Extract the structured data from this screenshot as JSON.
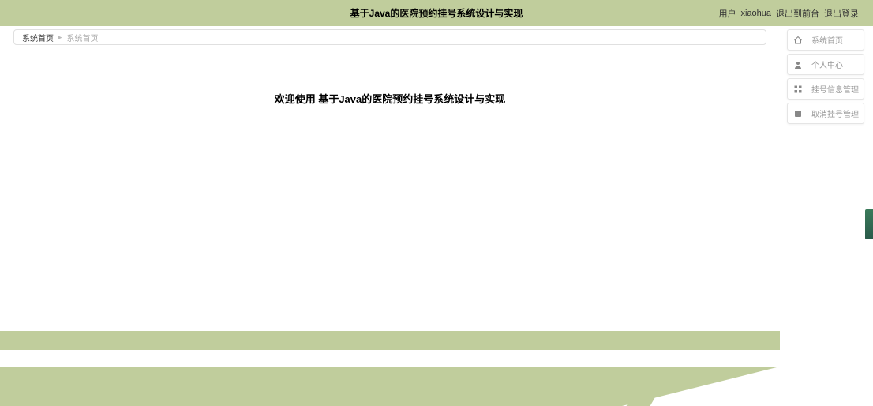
{
  "header": {
    "title": "基于Java的医院预约挂号系统设计与实现",
    "user_prefix": "用户",
    "username": "xiaohua",
    "back_label": "退出到前台",
    "logout_label": "退出登录"
  },
  "breadcrumb": {
    "home": "系统首页",
    "current": "系统首页"
  },
  "main": {
    "welcome": "欢迎使用 基于Java的医院预约挂号系统设计与实现"
  },
  "sidebar": {
    "items": [
      {
        "icon": "home",
        "label": "系统首页"
      },
      {
        "icon": "user",
        "label": "个人中心"
      },
      {
        "icon": "grid",
        "label": "挂号信息管理"
      },
      {
        "icon": "cancel",
        "label": "取消挂号管理"
      }
    ]
  }
}
